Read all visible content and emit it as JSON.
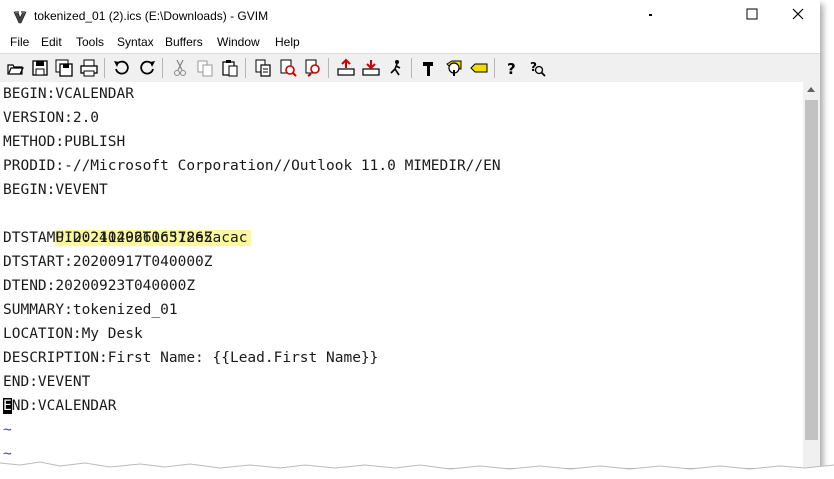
{
  "window": {
    "title": "tokenized_01 (2).ics (E:\\Downloads) - GVIM"
  },
  "window_controls": {
    "minimize_icon": "minimize-icon",
    "maximize_icon": "maximize-icon",
    "close_icon": "close-icon"
  },
  "menubar": {
    "items": [
      "File",
      "Edit",
      "Tools",
      "Syntax",
      "Buffers",
      "Window",
      "Help"
    ]
  },
  "toolbar": {
    "buttons": [
      "open-icon",
      "save-icon",
      "save-all-icon",
      "print-icon",
      "undo-icon",
      "redo-icon",
      "cut-icon",
      "copy-icon",
      "paste-icon",
      "replace-icon",
      "find-next-icon",
      "find-prev-icon",
      "load-session-icon",
      "save-session-icon",
      "run-script-icon",
      "make-icon",
      "build-tags-icon",
      "jump-tag-icon",
      "help-icon",
      "find-help-icon"
    ]
  },
  "editor": {
    "lines": [
      "BEGIN:VCALENDAR",
      "VERSION:2.0",
      "METHOD:PUBLISH",
      "PRODID:-//Microsoft Corporation//Outlook 11.0 MIMEDIR//EN",
      "BEGIN:VEVENT",
      "UID:21129660c378e5acac",
      "DTSTAMP:20240402T165126Z",
      "DTSTART:20200917T040000Z",
      "DTEND:20200923T040000Z",
      "SUMMARY:tokenized_01",
      "LOCATION:My Desk",
      "DESCRIPTION:First Name: {{Lead.First Name}}",
      "END:VEVENT"
    ],
    "cursor_char": "E",
    "cursor_line_rest": "ND:VCALENDAR",
    "tilde_lines": [
      "~",
      "~"
    ],
    "highlight_color": "#fbf6a0"
  }
}
